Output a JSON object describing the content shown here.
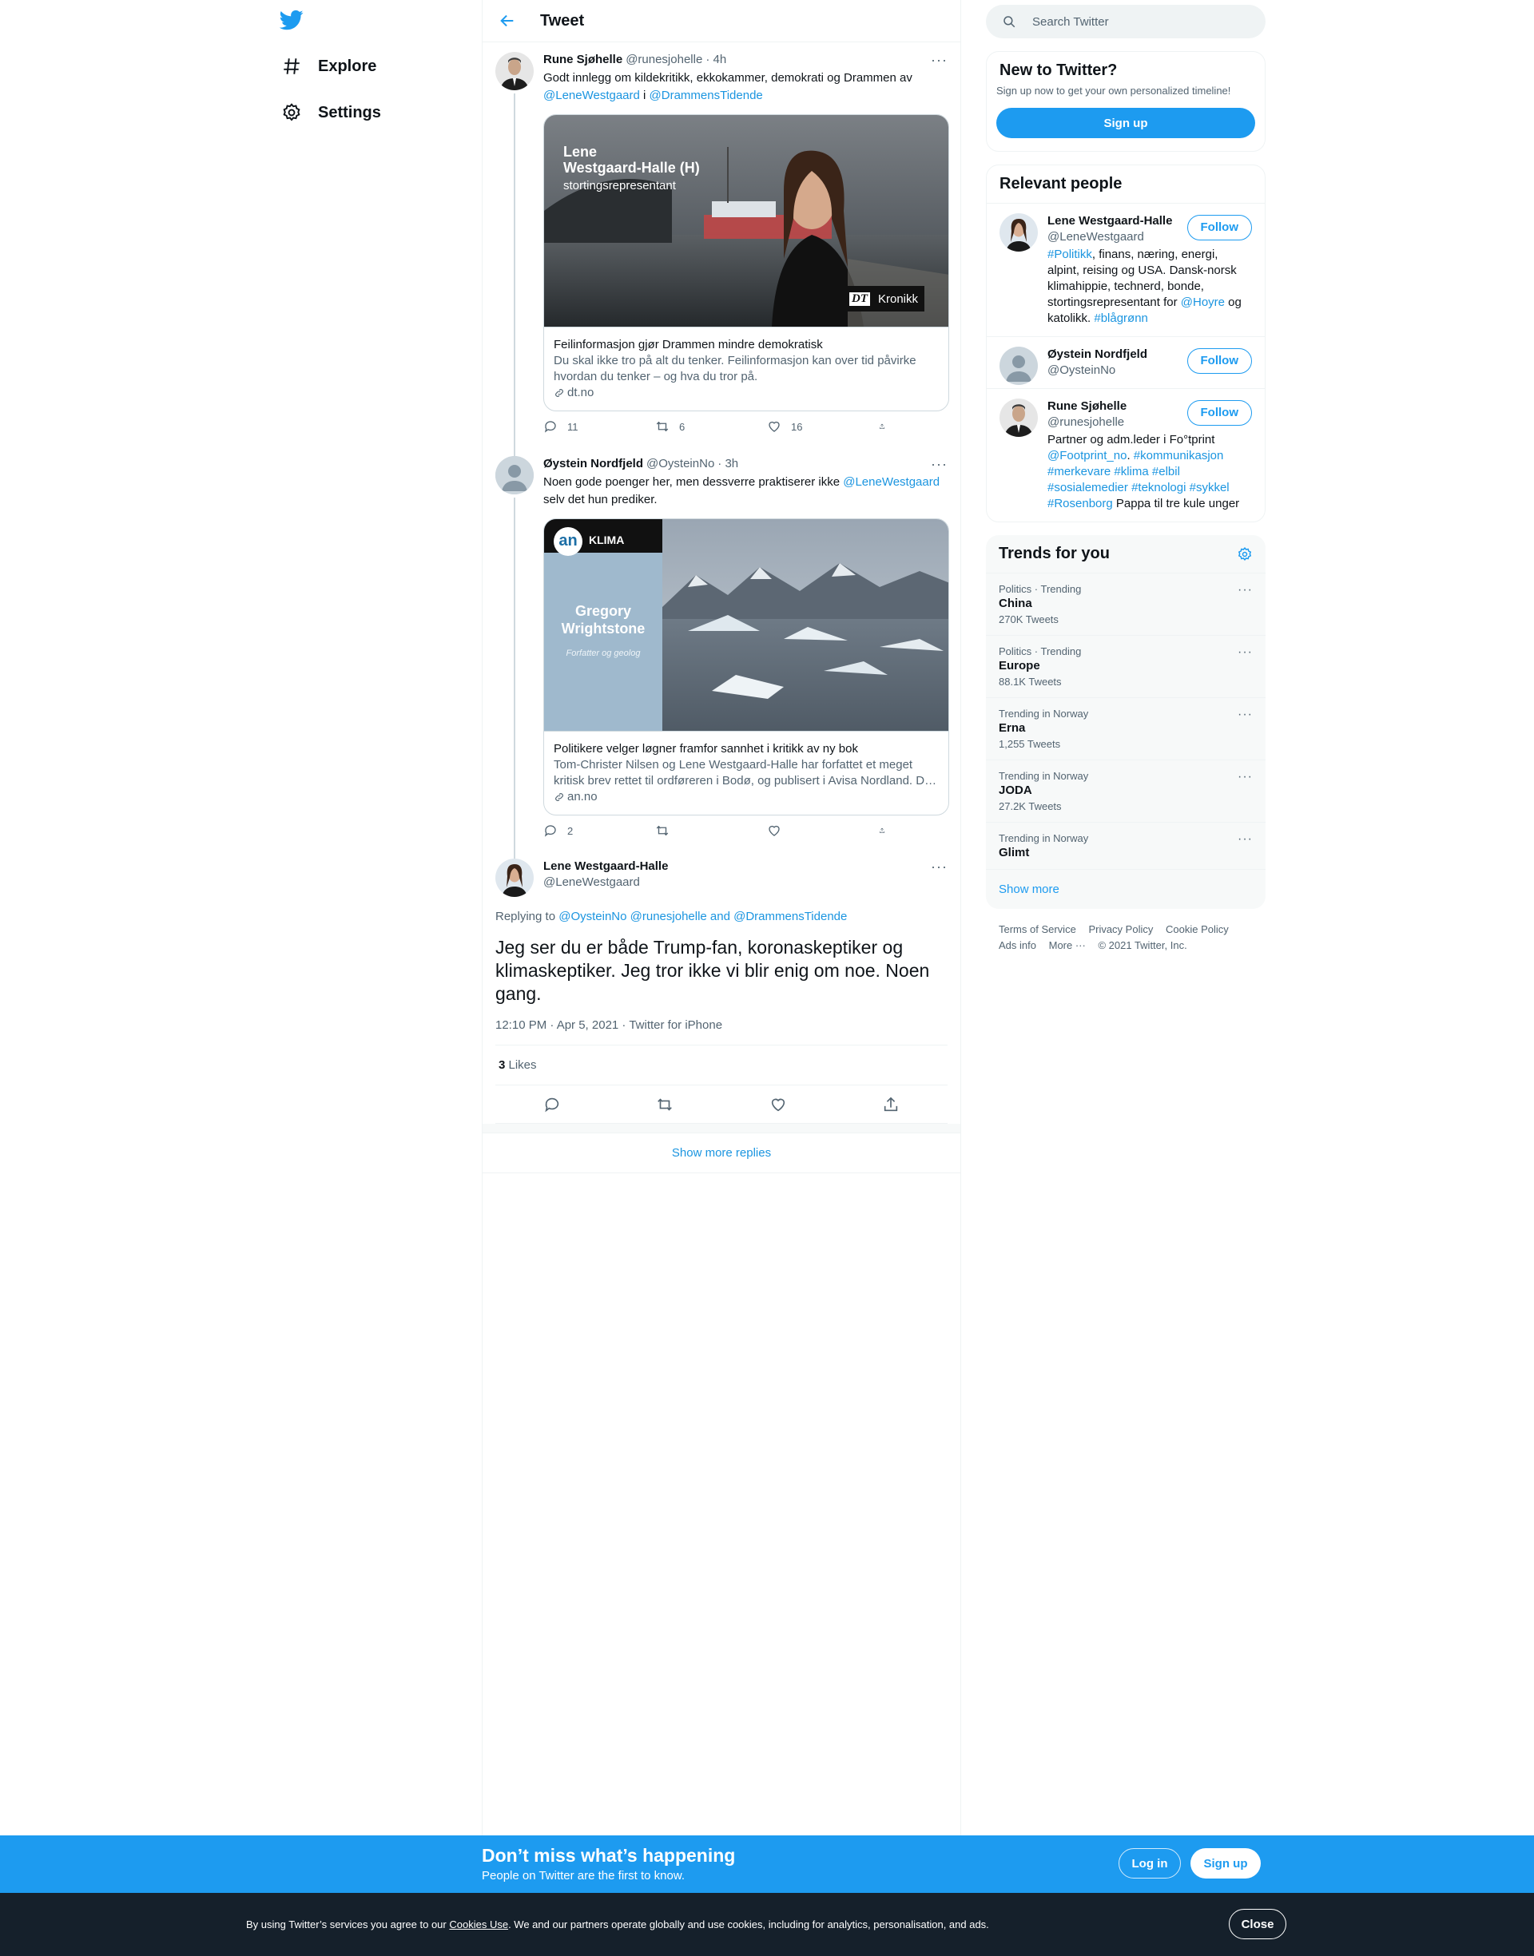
{
  "nav": {
    "explore": "Explore",
    "settings": "Settings"
  },
  "header": {
    "title": "Tweet"
  },
  "tweets": [
    {
      "name": "Rune Sjøhelle",
      "handle": "@runesjohelle",
      "time": "· 4h",
      "text_pre": "Godt innlegg om kildekritikk, ekkokammer, demokrati og Drammen av ",
      "mention1": "@LeneWestgaard",
      "text_mid": " i ",
      "mention2": "@DrammensTidende",
      "card": {
        "img_name": "Lene",
        "img_name2": "Westgaard-Halle (H)",
        "img_role": "stortingsrepresentant",
        "img_badge": "Kronikk",
        "img_logo": "DT",
        "title": "Feilinformasjon gjør Drammen mindre demokratisk",
        "desc": "Du skal ikke tro på alt du tenker. Feilinformasjon kan over tid påvirke hvordan du tenker – og hva du tror på.",
        "domain": "dt.no"
      },
      "replies": "11",
      "retweets": "6",
      "likes": "16"
    },
    {
      "name": "Øystein Nordfjeld",
      "handle": "@OysteinNo",
      "time": "· 3h",
      "text_pre": "Noen gode poenger her, men dessverre praktiserer ikke ",
      "mention1": "@LeneWestgaard",
      "text_post": " selv det hun prediker.",
      "card": {
        "img_logo": "an",
        "img_tag": "KLIMA",
        "img_name": "Gregory",
        "img_name2": "Wrightstone",
        "img_role": "Forfatter og geolog",
        "title": "Politikere velger løgner framfor sannhet i kritikk av ny bok",
        "desc": "Tom-Christer Nilsen og Lene Westgaard-Halle har forfattet et meget kritisk brev rettet til ordføreren i Bodø, og publisert i Avisa Nordland. D…",
        "domain": "an.no"
      },
      "replies": "2"
    }
  ],
  "focused": {
    "name": "Lene Westgaard-Halle",
    "handle": "@LeneWestgaard",
    "replying_label": "Replying to ",
    "replying_to": "@OysteinNo @runesjohelle and @DrammensTidende",
    "text": "Jeg ser du er både Trump-fan, koronaskeptiker og klimaskeptiker. Jeg tror ikke vi blir enig om noe. Noen gang.",
    "timestamp": "12:10 PM · Apr 5, 2021 · Twitter for iPhone",
    "likes_count": "3",
    "likes_label": " Likes"
  },
  "show_more_replies": "Show more replies",
  "search": {
    "placeholder": "Search Twitter"
  },
  "new_to_twitter": {
    "title": "New to Twitter?",
    "subtitle": "Sign up now to get your own personalized timeline!",
    "button": "Sign up"
  },
  "relevant": {
    "title": "Relevant people",
    "follow": "Follow",
    "people": [
      {
        "name": "Lene Westgaard-Halle",
        "handle": "@LeneWestgaard"
      },
      {
        "name": "Øystein Nordfjeld",
        "handle": "@OysteinNo"
      },
      {
        "name": "Rune Sjøhelle",
        "handle": "@runesjohelle"
      }
    ],
    "bio1": {
      "tag1": "#Politikk",
      "t1": ", finans, næring, energi, alpint, reising og USA. Dansk-norsk klimahippie, technerd, bonde, stortingsrepresentant for ",
      "tag2": "@Hoyre",
      "t2": " og katolikk. ",
      "tag3": "#blågrønn"
    },
    "bio3": {
      "t1": "Partner og adm.leder i Fo°tprint ",
      "tag1": "@Footprint_no",
      "t2": ". ",
      "tag2": "#kommunikasjon",
      "tag3": "#merkevare",
      "tag4": "#klima",
      "tag5": "#elbil",
      "tag6": "#sosialemedier",
      "tag7": "#teknologi",
      "tag8": "#sykkel",
      "tag9": "#Rosenborg",
      "t3": " Pappa til tre kule unger"
    }
  },
  "trends": {
    "title": "Trends for you",
    "items": [
      {
        "meta": "Politics · Trending",
        "name": "China",
        "count": "270K Tweets"
      },
      {
        "meta": "Politics · Trending",
        "name": "Europe",
        "count": "88.1K Tweets"
      },
      {
        "meta": "Trending in Norway",
        "name": "Erna",
        "count": "1,255 Tweets"
      },
      {
        "meta": "Trending in Norway",
        "name": "JODA",
        "count": "27.2K Tweets"
      },
      {
        "meta": "Trending in Norway",
        "name": "Glimt",
        "count": ""
      }
    ],
    "show_more": "Show more"
  },
  "footer": {
    "terms": "Terms of Service",
    "privacy": "Privacy Policy",
    "cookie": "Cookie Policy",
    "ads": "Ads info",
    "more": "More ···",
    "copyright": "© 2021 Twitter, Inc."
  },
  "dont_miss": {
    "title": "Don’t miss what’s happening",
    "subtitle": "People on Twitter are the first to know.",
    "login": "Log in",
    "signup": "Sign up"
  },
  "cookie_bar": {
    "pre": "By using Twitter’s services you agree to our ",
    "link": "Cookies Use",
    "post": ". We and our partners operate globally and use cookies, including for analytics, personalisation, and ads.",
    "close": "Close"
  },
  "colors": {
    "accent": "#1d9bf0",
    "dark_bar": "#15202b"
  }
}
